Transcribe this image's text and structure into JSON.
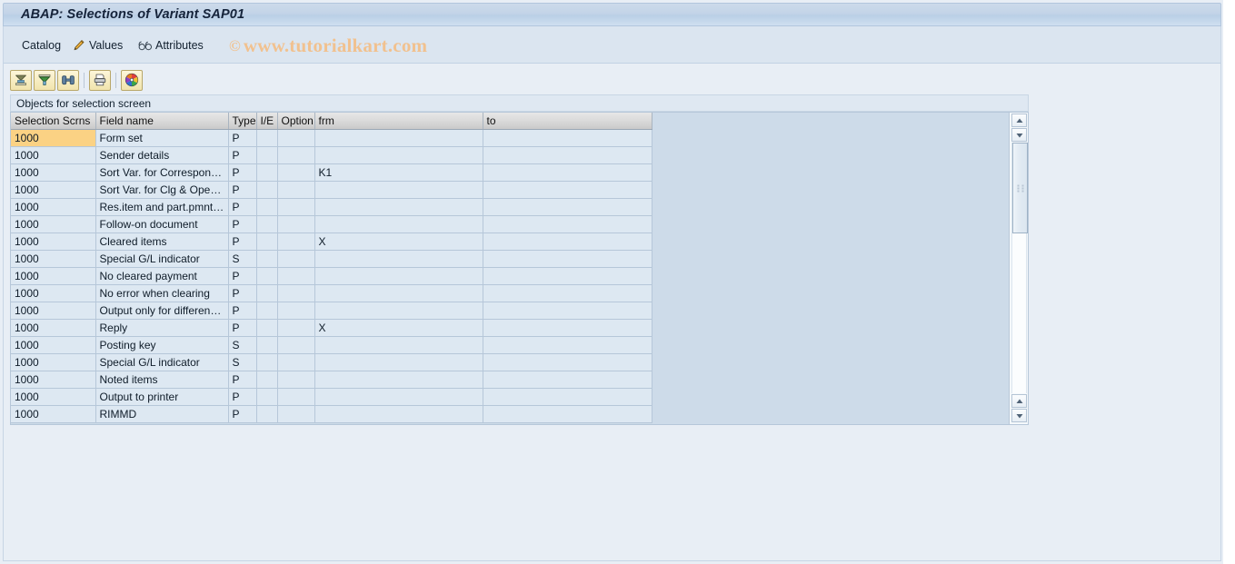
{
  "window": {
    "title": "ABAP: Selections of Variant SAP01"
  },
  "menu": {
    "items": [
      {
        "label": "Catalog",
        "icon": ""
      },
      {
        "label": "Values",
        "icon": "pencil-icon"
      },
      {
        "label": "Attributes",
        "icon": "glasses-icon"
      }
    ]
  },
  "watermark": {
    "copyright": "©",
    "text": "www.tutorialkart.com"
  },
  "toolbar": {
    "buttons": [
      {
        "name": "sort-ascending-button",
        "icon": "sort-ascending-icon",
        "tooltip": "Sort in ascending order"
      },
      {
        "name": "filter-button",
        "icon": "filter-icon",
        "tooltip": "Set filter"
      },
      {
        "name": "find-button",
        "icon": "binoculars-icon",
        "tooltip": "Find"
      },
      {
        "name": "print-button",
        "icon": "printer-icon",
        "tooltip": "Print"
      },
      {
        "name": "color-settings-button",
        "icon": "color-wheel-icon",
        "tooltip": "Display settings"
      }
    ]
  },
  "section": {
    "label": "Objects for selection screen"
  },
  "grid": {
    "columns": [
      {
        "key": "scrn",
        "label": "Selection Scrns"
      },
      {
        "key": "field",
        "label": "Field name"
      },
      {
        "key": "type",
        "label": "Type"
      },
      {
        "key": "ie",
        "label": "I/E"
      },
      {
        "key": "opt",
        "label": "Option"
      },
      {
        "key": "frm",
        "label": "frm"
      },
      {
        "key": "to",
        "label": "to"
      }
    ],
    "rows": [
      {
        "scrn": "1000",
        "field": "Form set",
        "type": "P",
        "ie": "",
        "opt": "",
        "frm": "",
        "to": "",
        "selected": true
      },
      {
        "scrn": "1000",
        "field": "Sender details",
        "type": "P",
        "ie": "",
        "opt": "",
        "frm": "",
        "to": ""
      },
      {
        "scrn": "1000",
        "field": "Sort Var. for Correspon…",
        "type": "P",
        "ie": "",
        "opt": "",
        "frm": "K1",
        "to": ""
      },
      {
        "scrn": "1000",
        "field": "Sort Var. for Clg & Ope…",
        "type": "P",
        "ie": "",
        "opt": "",
        "frm": "",
        "to": ""
      },
      {
        "scrn": "1000",
        "field": "Res.item and part.pmnt…",
        "type": "P",
        "ie": "",
        "opt": "",
        "frm": "",
        "to": ""
      },
      {
        "scrn": "1000",
        "field": "Follow-on document",
        "type": "P",
        "ie": "",
        "opt": "",
        "frm": "",
        "to": ""
      },
      {
        "scrn": "1000",
        "field": "Cleared items",
        "type": "P",
        "ie": "",
        "opt": "",
        "frm": "X",
        "to": ""
      },
      {
        "scrn": "1000",
        "field": "Special G/L indicator",
        "type": "S",
        "ie": "",
        "opt": "",
        "frm": "",
        "to": ""
      },
      {
        "scrn": "1000",
        "field": "No cleared payment",
        "type": "P",
        "ie": "",
        "opt": "",
        "frm": "",
        "to": ""
      },
      {
        "scrn": "1000",
        "field": "No error when clearing",
        "type": "P",
        "ie": "",
        "opt": "",
        "frm": "",
        "to": ""
      },
      {
        "scrn": "1000",
        "field": "Output only for differen…",
        "type": "P",
        "ie": "",
        "opt": "",
        "frm": "",
        "to": ""
      },
      {
        "scrn": "1000",
        "field": "Reply",
        "type": "P",
        "ie": "",
        "opt": "",
        "frm": "X",
        "to": ""
      },
      {
        "scrn": "1000",
        "field": "Posting key",
        "type": "S",
        "ie": "",
        "opt": "",
        "frm": "",
        "to": ""
      },
      {
        "scrn": "1000",
        "field": "Special G/L indicator",
        "type": "S",
        "ie": "",
        "opt": "",
        "frm": "",
        "to": ""
      },
      {
        "scrn": "1000",
        "field": "Noted items",
        "type": "P",
        "ie": "",
        "opt": "",
        "frm": "",
        "to": ""
      },
      {
        "scrn": "1000",
        "field": "Output to printer",
        "type": "P",
        "ie": "",
        "opt": "",
        "frm": "",
        "to": ""
      },
      {
        "scrn": "1000",
        "field": "RIMMD",
        "type": "P",
        "ie": "",
        "opt": "",
        "frm": "",
        "to": ""
      }
    ]
  },
  "colors": {
    "title_bar": "#c3d4e8",
    "menu_bar": "#dbe5f0",
    "page_background": "#e8eef5",
    "row_green": "#c9f2c0",
    "row_selected_orange": "#fbd284",
    "cell_blue": "#dde8f2",
    "watermark_orange": "#f3c08a",
    "grid_background": "#cddbe9"
  }
}
